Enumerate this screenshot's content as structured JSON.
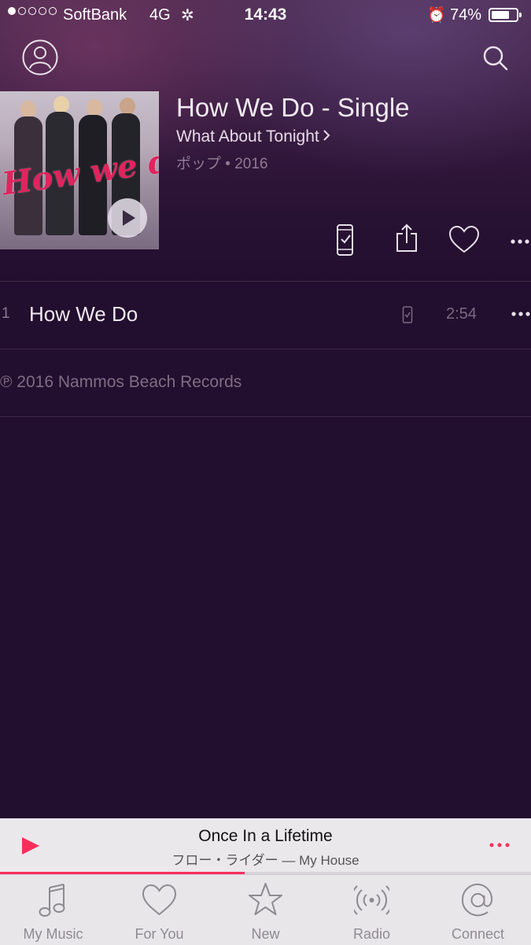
{
  "status_bar": {
    "signal_dots_filled": 1,
    "signal_dots_total": 5,
    "carrier": "SoftBank",
    "network": "4G",
    "time": "14:43",
    "battery_percent": "74%",
    "battery_level": 0.74
  },
  "album": {
    "title": "How We Do - Single",
    "artist": "What About Tonight",
    "genre_year": "ポップ • 2016",
    "art_script": "How we do"
  },
  "tracks": [
    {
      "number": "1",
      "title": "How We Do",
      "duration": "2:54"
    }
  ],
  "copyright": "℗ 2016 Nammos Beach Records",
  "now_playing": {
    "title": "Once In a Lifetime",
    "subtitle": "フロー・ライダー — My House",
    "progress": 0.46
  },
  "tabs": [
    {
      "label": "My Music",
      "icon": "music-note-icon"
    },
    {
      "label": "For You",
      "icon": "heart-icon"
    },
    {
      "label": "New",
      "icon": "star-icon"
    },
    {
      "label": "Radio",
      "icon": "radio-waves-icon"
    },
    {
      "label": "Connect",
      "icon": "at-sign-icon"
    }
  ],
  "colors": {
    "accent": "#fc2f5c",
    "background": "#220e2e",
    "tab_inactive": "#8e8b90"
  }
}
